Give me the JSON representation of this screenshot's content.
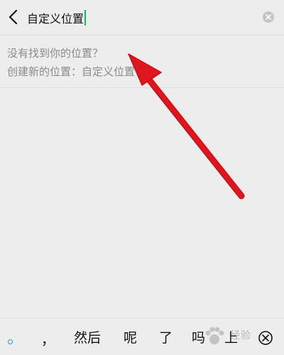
{
  "search": {
    "query": "自定义位置"
  },
  "result": {
    "not_found_text": "没有找到你的位置？",
    "create_text": "创建新的位置：自定义位置"
  },
  "keyboard": {
    "candidates": [
      "，",
      "然后",
      "呢",
      "了",
      "吗",
      "上"
    ]
  },
  "watermark": {
    "text": "经验"
  },
  "colors": {
    "background": "#ededed",
    "caret": "#07c160",
    "annotation_arrow": "#e0161e",
    "candidate_dot": "#2a93e6"
  },
  "icons": {
    "back": "chevron-left-icon",
    "clear": "clear-circle-icon",
    "delete": "delete-circle-x-icon"
  }
}
